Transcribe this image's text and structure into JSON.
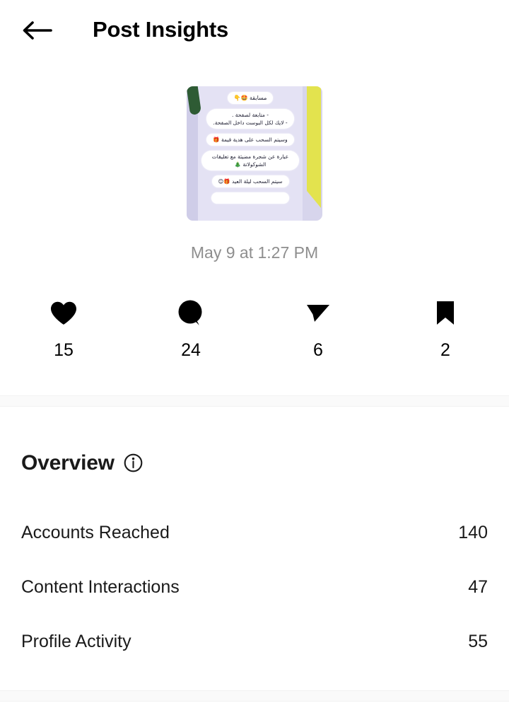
{
  "header": {
    "back_icon": "arrow-left-icon",
    "title": "Post Insights"
  },
  "post": {
    "thumbnail": {
      "alt": "post-thumbnail",
      "bubbles": [
        "مسابقة 🤩👇",
        "- متابعة لصفحة .\n- لايك لكل البوست داخل الصفحة.",
        "وسيتم السحب على هدية قيمة 🎁",
        "عبارة عن شجرة مضيئة مع تعليقات الشوكولاتة 🎄",
        "سيتم السحب ليلة العيد 🎁😊"
      ],
      "accent_left_color": "#2e5b34",
      "accent_right_color": "#e3e34e",
      "background_color": "#e4e2f4"
    },
    "date": "May 9 at 1:27 PM"
  },
  "engagement": [
    {
      "icon": "heart-icon",
      "name": "likes",
      "count": "15"
    },
    {
      "icon": "comment-icon",
      "name": "comments",
      "count": "24"
    },
    {
      "icon": "share-icon",
      "name": "shares",
      "count": "6"
    },
    {
      "icon": "bookmark-icon",
      "name": "saves",
      "count": "2"
    }
  ],
  "overview": {
    "title": "Overview",
    "info_icon": "info-icon",
    "metrics": [
      {
        "label": "Accounts Reached",
        "value": "140"
      },
      {
        "label": "Content Interactions",
        "value": "47"
      },
      {
        "label": "Profile Activity",
        "value": "55"
      }
    ]
  },
  "colors": {
    "text_primary": "#000000",
    "text_secondary": "#8e8e8e",
    "background": "#ffffff",
    "separator": "#fafafa"
  }
}
